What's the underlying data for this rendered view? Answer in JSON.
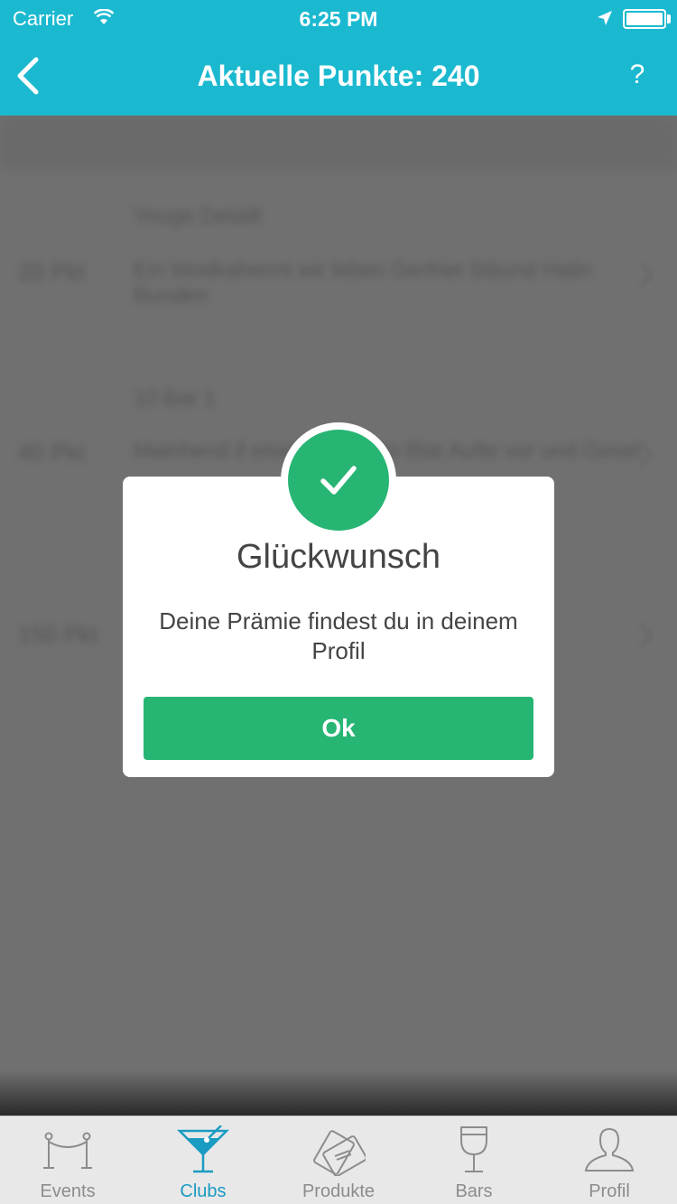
{
  "status_bar": {
    "carrier": "Carrier",
    "time": "6:25 PM"
  },
  "nav": {
    "title": "Aktuelle Punkte: 240",
    "help": "?"
  },
  "background_rows": [
    {
      "points": "",
      "text": "Youge Detailt",
      "kind": "heading"
    },
    {
      "points": "20 Pkt",
      "text": "Ein Wodkahennt wir leben Gerfriet Sibund Halin",
      "text2": "Bunden",
      "kind": "row"
    },
    {
      "points": "",
      "text": "10 Bar 1",
      "kind": "heading"
    },
    {
      "points": "40 Pkt",
      "text": "Mainhend if eisen Plawer to Blat Aufte vor und Geset",
      "kind": "row"
    },
    {
      "points": "150 Pkt",
      "text": "",
      "kind": "row"
    }
  ],
  "modal": {
    "title": "Glückwunsch",
    "message": "Deine Prämie findest du in deinem Profil",
    "ok_label": "Ok"
  },
  "tabs": [
    {
      "label": "Events",
      "icon": "rope-barrier-icon",
      "active": false
    },
    {
      "label": "Clubs",
      "icon": "cocktail-icon",
      "active": true
    },
    {
      "label": "Produkte",
      "icon": "cards-icon",
      "active": false
    },
    {
      "label": "Bars",
      "icon": "wine-glass-icon",
      "active": false
    },
    {
      "label": "Profil",
      "icon": "person-icon",
      "active": false
    }
  ],
  "colors": {
    "accent": "#1bb9d0",
    "success": "#27b573",
    "tab_active": "#1a9bc2",
    "overlay": "#707070"
  }
}
